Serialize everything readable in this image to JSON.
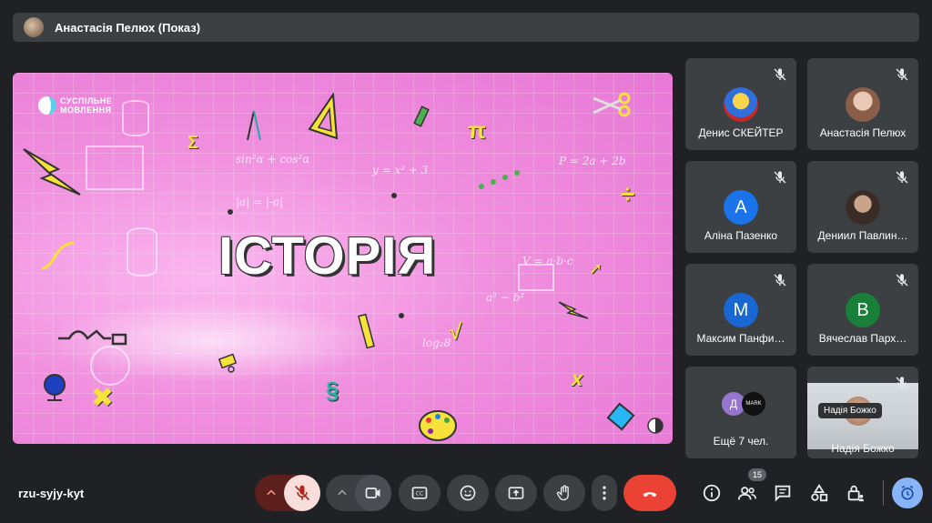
{
  "presenter": {
    "label": "Анастасія Пелюх (Показ)"
  },
  "stage": {
    "title": "ІСТОРІЯ",
    "logo_line1": "СУСПІЛЬНЕ",
    "logo_line2": "МОВЛЕННЯ"
  },
  "participants": [
    {
      "name": "Денис СКЕЙТЕР",
      "avatar": "",
      "muted": true
    },
    {
      "name": "Анастасія Пелюх",
      "avatar": "",
      "muted": true
    },
    {
      "name": "Аліна Пазенко",
      "avatar": "А",
      "color": "#1a73e8",
      "muted": true
    },
    {
      "name": "Дениил Павлин…",
      "avatar": "",
      "muted": true
    },
    {
      "name": "Максим Панфи…",
      "avatar": "M",
      "color": "#1967d2",
      "muted": true
    },
    {
      "name": "Вячеслав Парх…",
      "avatar": "B",
      "color": "#188038",
      "muted": true
    },
    {
      "name": "Ещё 7 чел.",
      "avatar1": "Д",
      "avatar2": "MARK"
    },
    {
      "name": "Надія Божко",
      "tooltip": "Надія Божко",
      "muted": true
    }
  ],
  "meeting": {
    "code": "rzu-syjy-kyt",
    "participant_count": "15"
  },
  "colors": {
    "background": "#202124",
    "tile": "#3c4043",
    "end_call": "#ea4335",
    "mic_off": "#f9dedc",
    "accent": "#8ab4f8"
  }
}
